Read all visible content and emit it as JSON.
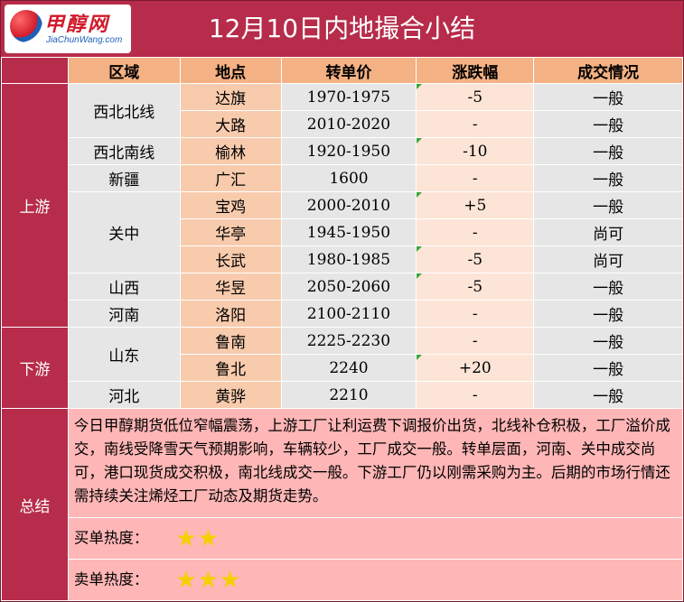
{
  "header": {
    "logo_cn": "甲醇网",
    "logo_en": "JiaChunWang.com",
    "title": "12月10日内地撮合小结"
  },
  "columns": [
    "区域",
    "地点",
    "转单价",
    "涨跌幅",
    "成交情况"
  ],
  "segments": {
    "upstream": "上游",
    "downstream": "下游",
    "summary": "总结"
  },
  "areas": {
    "northwest_north": "西北北线",
    "northwest_south": "西北南线",
    "xinjiang": "新疆",
    "guanzhong": "关中",
    "shanxi": "山西",
    "henan": "河南",
    "shandong": "山东",
    "hebei": "河北"
  },
  "rows": [
    {
      "location": "达旗",
      "price": "1970-1975",
      "change": "-5",
      "status": "一般"
    },
    {
      "location": "大路",
      "price": "2010-2020",
      "change": "-",
      "status": "一般"
    },
    {
      "location": "榆林",
      "price": "1920-1950",
      "change": "-10",
      "status": "一般"
    },
    {
      "location": "广汇",
      "price": "1600",
      "change": "-",
      "status": "一般"
    },
    {
      "location": "宝鸡",
      "price": "2000-2010",
      "change": "+5",
      "status": "一般"
    },
    {
      "location": "华亭",
      "price": "1945-1950",
      "change": "-",
      "status": "尚可"
    },
    {
      "location": "长武",
      "price": "1980-1985",
      "change": "-5",
      "status": "尚可"
    },
    {
      "location": "华昱",
      "price": "2050-2060",
      "change": "-5",
      "status": "一般"
    },
    {
      "location": "洛阳",
      "price": "2100-2110",
      "change": "-",
      "status": "一般"
    },
    {
      "location": "鲁南",
      "price": "2225-2230",
      "change": "-",
      "status": "一般"
    },
    {
      "location": "鲁北",
      "price": "2240",
      "change": "+20",
      "status": "一般"
    },
    {
      "location": "黄骅",
      "price": "2210",
      "change": "-",
      "status": "一般"
    }
  ],
  "summary": {
    "text": "今日甲醇期货低位窄幅震荡，上游工厂让利运费下调报价出货，北线补仓积极，工厂溢价成交，南线受降雪天气预期影响，车辆较少，工厂成交一般。转单层面，河南、关中成交尚可，港口现货成交积极，南北线成交一般。下游工厂仍以刚需采购为主。后期的市场行情还需持续关注烯烃工厂动态及期货走势。",
    "buy_label": "买单热度：",
    "buy_stars": "★★",
    "sell_label": "卖单热度：",
    "sell_stars": "★★★"
  }
}
